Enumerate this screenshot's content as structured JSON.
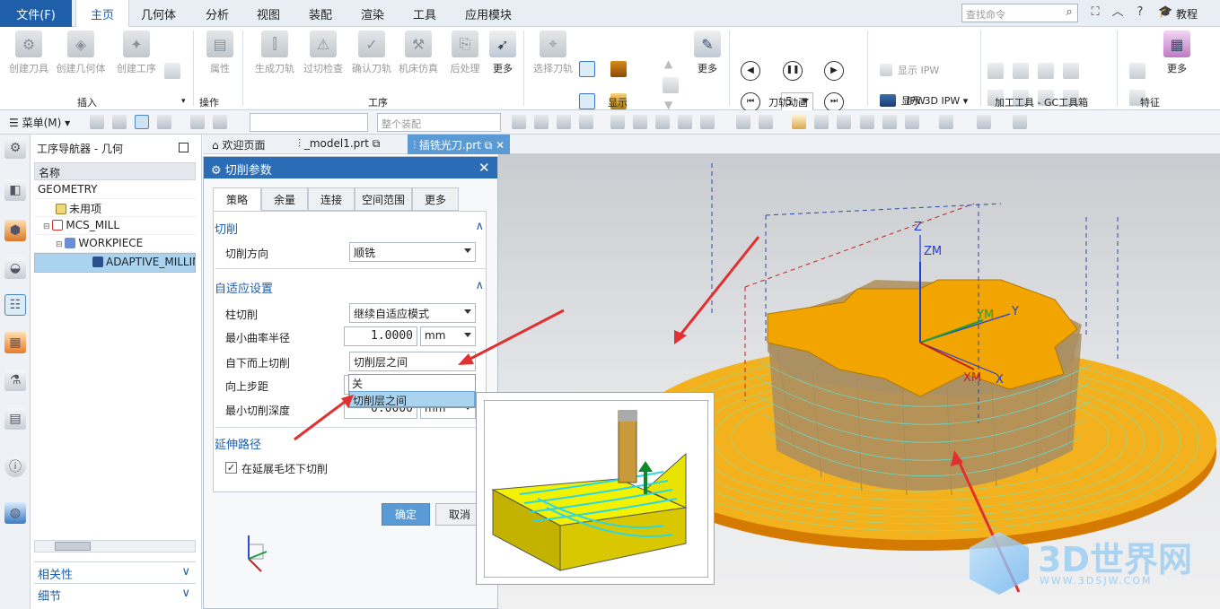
{
  "menu": {
    "file": "文件(F)",
    "tabs": [
      "主页",
      "几何体",
      "分析",
      "视图",
      "装配",
      "渲染",
      "工具",
      "应用模块"
    ],
    "search_placeholder": "查找命令",
    "tutorial": "教程"
  },
  "ribbon": {
    "insert": {
      "items": [
        "创建刀具",
        "创建几何体",
        "创建工序"
      ],
      "label": "插入"
    },
    "operation": {
      "item": "属性",
      "label": "操作"
    },
    "process": {
      "items": [
        "生成刀轨",
        "过切检查",
        "确认刀轨",
        "机床仿真",
        "后处理"
      ],
      "more": "更多",
      "label": "工序"
    },
    "display": {
      "item": "选择刀轨",
      "more": "更多",
      "label": "显示"
    },
    "animation": {
      "speed": "5",
      "label": "刀轨动画"
    },
    "ipw": {
      "show": "显示 IPW",
      "show3d": "显示 3D IPW",
      "label": "IPW"
    },
    "gc": {
      "label": "加工工具 - GC工具箱"
    },
    "feature": {
      "more": "更多",
      "label": "特征"
    }
  },
  "toolbar": {
    "menu": "菜单(M)",
    "assembly": "整个装配"
  },
  "navigator": {
    "title": "工序导航器 - 几何",
    "column": "名称",
    "rows": [
      "GEOMETRY",
      "未用项",
      "MCS_MILL",
      "WORKPIECE",
      "ADAPTIVE_MILLING"
    ],
    "related": "相关性",
    "details": "细节"
  },
  "doctabs": [
    "欢迎页面",
    "_model1.prt",
    "插铣光刀.prt"
  ],
  "dialog": {
    "title": "切削参数",
    "tabs": [
      "策略",
      "余量",
      "连接",
      "空间范围",
      "更多"
    ],
    "cut_section": "切削",
    "cut_dir_label": "切削方向",
    "cut_dir_value": "顺铣",
    "adaptive_section": "自适应设置",
    "column_cut_label": "柱切削",
    "column_cut_value": "继续自适应模式",
    "min_radius_label": "最小曲率半径",
    "min_radius_value": "1.0000",
    "min_radius_unit": "mm",
    "bottom_up_label": "自下而上切削",
    "bottom_up_value": "切削层之间",
    "popup_options": [
      "关",
      "切削层之间"
    ],
    "step_up_label": "向上步距",
    "min_depth_label": "最小切削深度",
    "min_depth_value": "0.0000",
    "min_depth_unit": "mm",
    "extend_section": "延伸路径",
    "extend_check": "在延展毛坯下切削",
    "ok": "确定",
    "cancel": "取消"
  },
  "viewport": {
    "axis_z": "Z",
    "axis_zm": "ZM",
    "axis_ym": "YM",
    "axis_y": "Y",
    "axis_xm": "XM",
    "axis_x": "X"
  },
  "watermark": {
    "brand": "3D世界网",
    "url": "WWW.3DSJW.COM"
  },
  "colors": {
    "accent": "#2b6cb6",
    "part_orange": "#f0a500",
    "toolpath_cyan": "#2fe0e0",
    "arrow_red": "#e03030"
  }
}
